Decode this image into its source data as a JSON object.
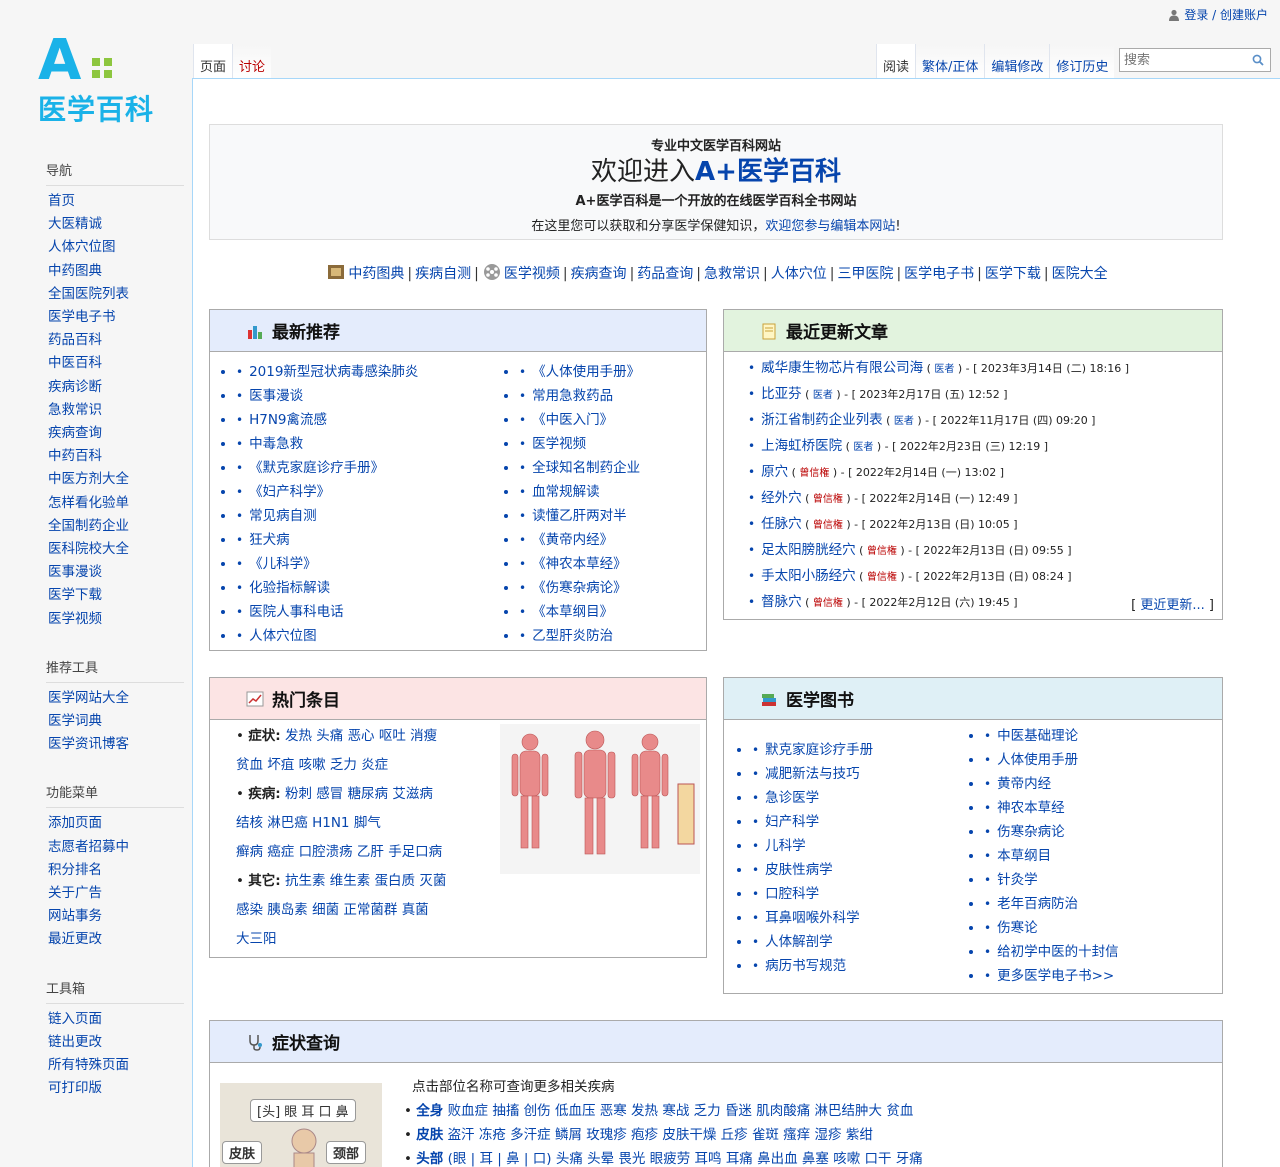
{
  "personal": {
    "login": "登录 / 创建账户"
  },
  "logo": {
    "letter": "A",
    "name": "医学百科"
  },
  "tabs": {
    "left": [
      "页面",
      "讨论"
    ],
    "right": [
      "阅读",
      "繁体/正体",
      "编辑修改",
      "修订历史"
    ]
  },
  "search": {
    "placeholder": "搜索"
  },
  "sidebar": [
    {
      "title": "导航",
      "items": [
        "首页",
        "大医精诚",
        "人体穴位图",
        "中药图典",
        "全国医院列表",
        "医学电子书",
        "药品百科",
        "中医百科",
        "疾病诊断",
        "急救常识",
        "疾病查询",
        "中药百科",
        "中医方剂大全",
        "怎样看化验单",
        "全国制药企业",
        "医科院校大全",
        "医事漫谈",
        "医学下载",
        "医学视频"
      ]
    },
    {
      "title": "推荐工具",
      "items": [
        "医学网站大全",
        "医学词典",
        "医学资讯博客"
      ]
    },
    {
      "title": "功能菜单",
      "items": [
        "添加页面",
        "志愿者招募中",
        "积分排名",
        "关于广告",
        "网站事务",
        "最近更改"
      ]
    },
    {
      "title": "工具箱",
      "items": [
        "链入页面",
        "链出更改",
        "所有特殊页面",
        "可打印版"
      ]
    }
  ],
  "welcome": {
    "tag": "专业中文医学百科网站",
    "headline_pre": "欢迎进入",
    "headline_brand": "A+医学百科",
    "line1_a": "A+医学百科是一个开放的",
    "line1_b": "在线医学百科全书网站",
    "line2_a": "在这里您可以获取和分享医学保健知识，",
    "line2_link": "欢迎您参与编辑本网站",
    "line2_end": "!"
  },
  "quicklinks": [
    "中药图典",
    "疾病自测",
    "医学视频",
    "疾病查询",
    "药品查询",
    "急救常识",
    "人体穴位",
    "三甲医院",
    "医学电子书",
    "医学下载",
    "医院大全"
  ],
  "latest": {
    "title": "最新推荐",
    "col1": [
      "2019新型冠状病毒感染肺炎",
      "医事漫谈",
      "H7N9禽流感",
      "中毒急救",
      "《默克家庭诊疗手册》",
      "《妇产科学》",
      "常见病自测",
      "狂犬病",
      "《儿科学》",
      "化验指标解读",
      "医院人事科电话",
      "人体穴位图"
    ],
    "col2": [
      "《人体使用手册》",
      "常用急救药品",
      "《中医入门》",
      "医学视频",
      "全球知名制药企业",
      "血常规解读",
      "读懂乙肝两对半",
      "《黄帝内经》",
      "《神农本草经》",
      "《伤寒杂病论》",
      "《本草纲目》",
      "乙型肝炎防治"
    ]
  },
  "recent": {
    "title": "最近更新文章",
    "items": [
      {
        "name": "威华康生物芯片有限公司海",
        "who": "医者",
        "time": "2023年3月14日 (二) 18:16",
        "red": false
      },
      {
        "name": "比亚芬",
        "who": "医者",
        "time": "2023年2月17日 (五) 12:52",
        "red": false
      },
      {
        "name": "浙江省制药企业列表",
        "who": "医者",
        "time": "2022年11月17日 (四) 09:20",
        "red": false
      },
      {
        "name": "上海虹桥医院",
        "who": "医者",
        "time": "2022年2月23日 (三) 12:19",
        "red": false
      },
      {
        "name": "原穴",
        "who": "曾信権",
        "time": "2022年2月14日 (一) 13:02",
        "red": true
      },
      {
        "name": "经外穴",
        "who": "曾信権",
        "time": "2022年2月14日 (一) 12:49",
        "red": true
      },
      {
        "name": "任脉穴",
        "who": "曾信権",
        "time": "2022年2月13日 (日) 10:05",
        "red": true
      },
      {
        "name": "足太阳膀胱经穴",
        "who": "曾信権",
        "time": "2022年2月13日 (日) 09:55",
        "red": true
      },
      {
        "name": "手太阳小肠经穴",
        "who": "曾信権",
        "time": "2022年2月13日 (日) 08:24",
        "red": true
      },
      {
        "name": "督脉穴",
        "who": "曾信権",
        "time": "2022年2月12日 (六) 19:45",
        "red": true
      }
    ],
    "more": "更近更新..."
  },
  "hot": {
    "title": "热门条目",
    "rows": [
      {
        "label": "症状:",
        "links": [
          "发热",
          "头痛",
          "恶心",
          "呕吐",
          "消瘦"
        ]
      },
      {
        "label": "",
        "links": [
          "贫血",
          "坏疽",
          "咳嗽",
          "乏力",
          "炎症"
        ]
      },
      {
        "label": "疾病:",
        "links": [
          "粉刺",
          "感冒",
          "糖尿病",
          "艾滋病"
        ]
      },
      {
        "label": "",
        "links": [
          "结核",
          "淋巴癌",
          "H1N1",
          "脚气"
        ]
      },
      {
        "label": "",
        "links": [
          "癣病",
          "癌症",
          "口腔溃疡",
          "乙肝",
          "手足口病"
        ]
      },
      {
        "label": "其它:",
        "links": [
          "抗生素",
          "维生素",
          "蛋白质",
          "灭菌"
        ]
      },
      {
        "label": "",
        "links": [
          "感染",
          "胰岛素",
          "细菌",
          "正常菌群",
          "真菌"
        ]
      },
      {
        "label": "",
        "links": [
          "大三阳"
        ]
      }
    ]
  },
  "books": {
    "title": "医学图书",
    "col1": [
      "默克家庭诊疗手册",
      "减肥新法与技巧",
      "急诊医学",
      "妇产科学",
      "儿科学",
      "皮肤性病学",
      "口腔科学",
      "耳鼻咽喉外科学",
      "人体解剖学",
      "病历书写规范"
    ],
    "col2": [
      "中医基础理论",
      "人体使用手册",
      "黄帝内经",
      "神农本草经",
      "伤寒杂病论",
      "本草纲目",
      "针灸学",
      "老年百病防治",
      "伤寒论",
      "给初学中医的十封信",
      "更多医学电子书>>"
    ]
  },
  "symptom": {
    "title": "症状查询",
    "hint": "点击部位名称可查询更多相关疾病",
    "img_labels": {
      "head": "[头] 眼 耳 口 鼻",
      "skin": "皮肤",
      "neck": "颈部"
    },
    "rows": [
      {
        "label": "全身",
        "links": [
          "败血症",
          "抽搐",
          "创伤",
          "低血压",
          "恶寒",
          "发热",
          "寒战",
          "乏力",
          "昏迷",
          "肌肉酸痛",
          "淋巴结肿大",
          "贫血"
        ]
      },
      {
        "label": "皮肤",
        "links": [
          "盗汗",
          "冻疮",
          "多汗症",
          "鳞屑",
          "玫瑰疹",
          "疱疹",
          "皮肤干燥",
          "丘疹",
          "雀斑",
          "瘙痒",
          "湿疹",
          "紫绀"
        ]
      },
      {
        "label": "头部",
        "links": [
          "(眼",
          "| 耳",
          "| 鼻",
          "| 口)",
          "头痛",
          "头晕",
          "畏光",
          "眼疲劳",
          "耳鸣",
          "耳痛",
          "鼻出血",
          "鼻塞",
          "咳嗽",
          "口干",
          "牙痛"
        ]
      }
    ]
  }
}
